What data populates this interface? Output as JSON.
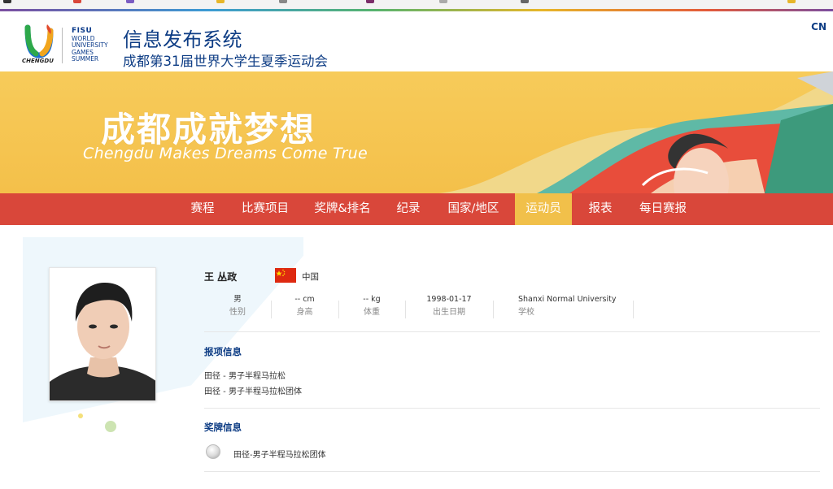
{
  "header": {
    "logo_city": "CHENGDU",
    "fisu_title": "FISU",
    "fisu_lines": [
      "WORLD",
      "UNIVERSITY",
      "GAMES",
      "SUMMER"
    ],
    "title": "信息发布系统",
    "subtitle": "成都第31届世界大学生夏季运动会",
    "language": "CN"
  },
  "banner": {
    "slogan_cn": "成都成就梦想",
    "slogan_en": "Chengdu Makes Dreams Come True"
  },
  "nav": {
    "items": [
      {
        "label": "赛程"
      },
      {
        "label": "比赛项目"
      },
      {
        "label": "奖牌&排名"
      },
      {
        "label": "纪录"
      },
      {
        "label": "国家/地区"
      },
      {
        "label": "运动员"
      },
      {
        "label": "报表"
      },
      {
        "label": "每日赛报"
      }
    ],
    "active": "运动员"
  },
  "athlete": {
    "name": "王 丛政",
    "country": "中国",
    "stats": [
      {
        "value": "男",
        "label": "性别"
      },
      {
        "value": "-- cm",
        "label": "身高"
      },
      {
        "value": "-- kg",
        "label": "体重"
      },
      {
        "value": "1998-01-17",
        "label": "出生日期"
      },
      {
        "value": "Shanxi Normal University",
        "label": "学校"
      }
    ]
  },
  "entries": {
    "title": "报项信息",
    "items": [
      "田径 - 男子半程马拉松",
      "田径 - 男子半程马拉松团体"
    ]
  },
  "medals": {
    "title": "奖牌信息",
    "items": [
      {
        "event": "田径-男子半程马拉松团体",
        "medal_icon": "silver-medal-icon"
      }
    ]
  },
  "colors": {
    "nav_bg": "#d9473a",
    "nav_active": "#f1c04a",
    "banner_bg": "#f4c04a",
    "title_blue": "#0d3c84"
  }
}
